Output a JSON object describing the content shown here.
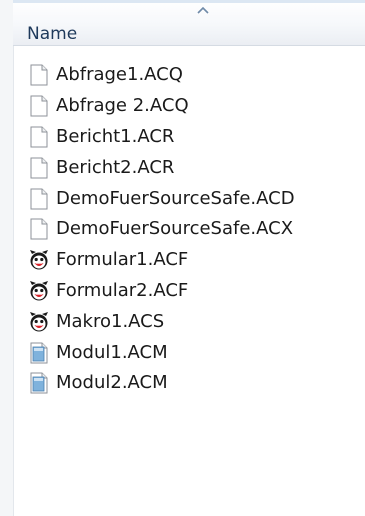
{
  "header": {
    "column_name": "Name"
  },
  "files": [
    {
      "name": "Abfrage1.ACQ",
      "icon": "generic-file-icon"
    },
    {
      "name": "Abfrage 2.ACQ",
      "icon": "generic-file-icon"
    },
    {
      "name": "Bericht1.ACR",
      "icon": "generic-file-icon"
    },
    {
      "name": "Bericht2.ACR",
      "icon": "generic-file-icon"
    },
    {
      "name": "DemoFuerSourceSafe.ACD",
      "icon": "generic-file-icon"
    },
    {
      "name": "DemoFuerSourceSafe.ACX",
      "icon": "generic-file-icon"
    },
    {
      "name": "Formular1.ACF",
      "icon": "face-icon"
    },
    {
      "name": "Formular2.ACF",
      "icon": "face-icon"
    },
    {
      "name": "Makro1.ACS",
      "icon": "face-icon"
    },
    {
      "name": "Modul1.ACM",
      "icon": "module-file-icon"
    },
    {
      "name": "Modul2.ACM",
      "icon": "module-file-icon"
    }
  ]
}
